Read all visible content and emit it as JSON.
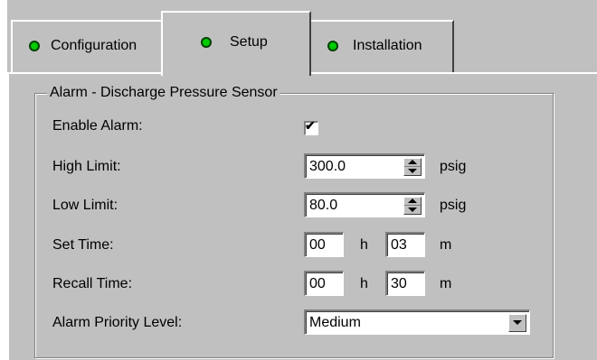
{
  "tabs": [
    {
      "label": "Configuration",
      "selected": false
    },
    {
      "label": "Setup",
      "selected": true
    },
    {
      "label": "Installation",
      "selected": false
    }
  ],
  "group": {
    "title": "Alarm - Discharge Pressure Sensor"
  },
  "fields": {
    "enable_alarm": {
      "label": "Enable Alarm:",
      "checked": true,
      "mark": "✔"
    },
    "high_limit": {
      "label": "High Limit:",
      "value": "300.0",
      "unit": "psig"
    },
    "low_limit": {
      "label": "Low Limit:",
      "value": "80.0",
      "unit": "psig"
    },
    "set_time": {
      "label": "Set Time:",
      "hours": "00",
      "hours_unit": "h",
      "minutes": "03",
      "minutes_unit": "m"
    },
    "recall_time": {
      "label": "Recall Time:",
      "hours": "00",
      "hours_unit": "h",
      "minutes": "30",
      "minutes_unit": "m"
    },
    "alarm_priority": {
      "label": "Alarm Priority Level:",
      "value": "Medium"
    }
  },
  "colors": {
    "status_dot": "#00cc00",
    "face": "#c0c0c0"
  }
}
